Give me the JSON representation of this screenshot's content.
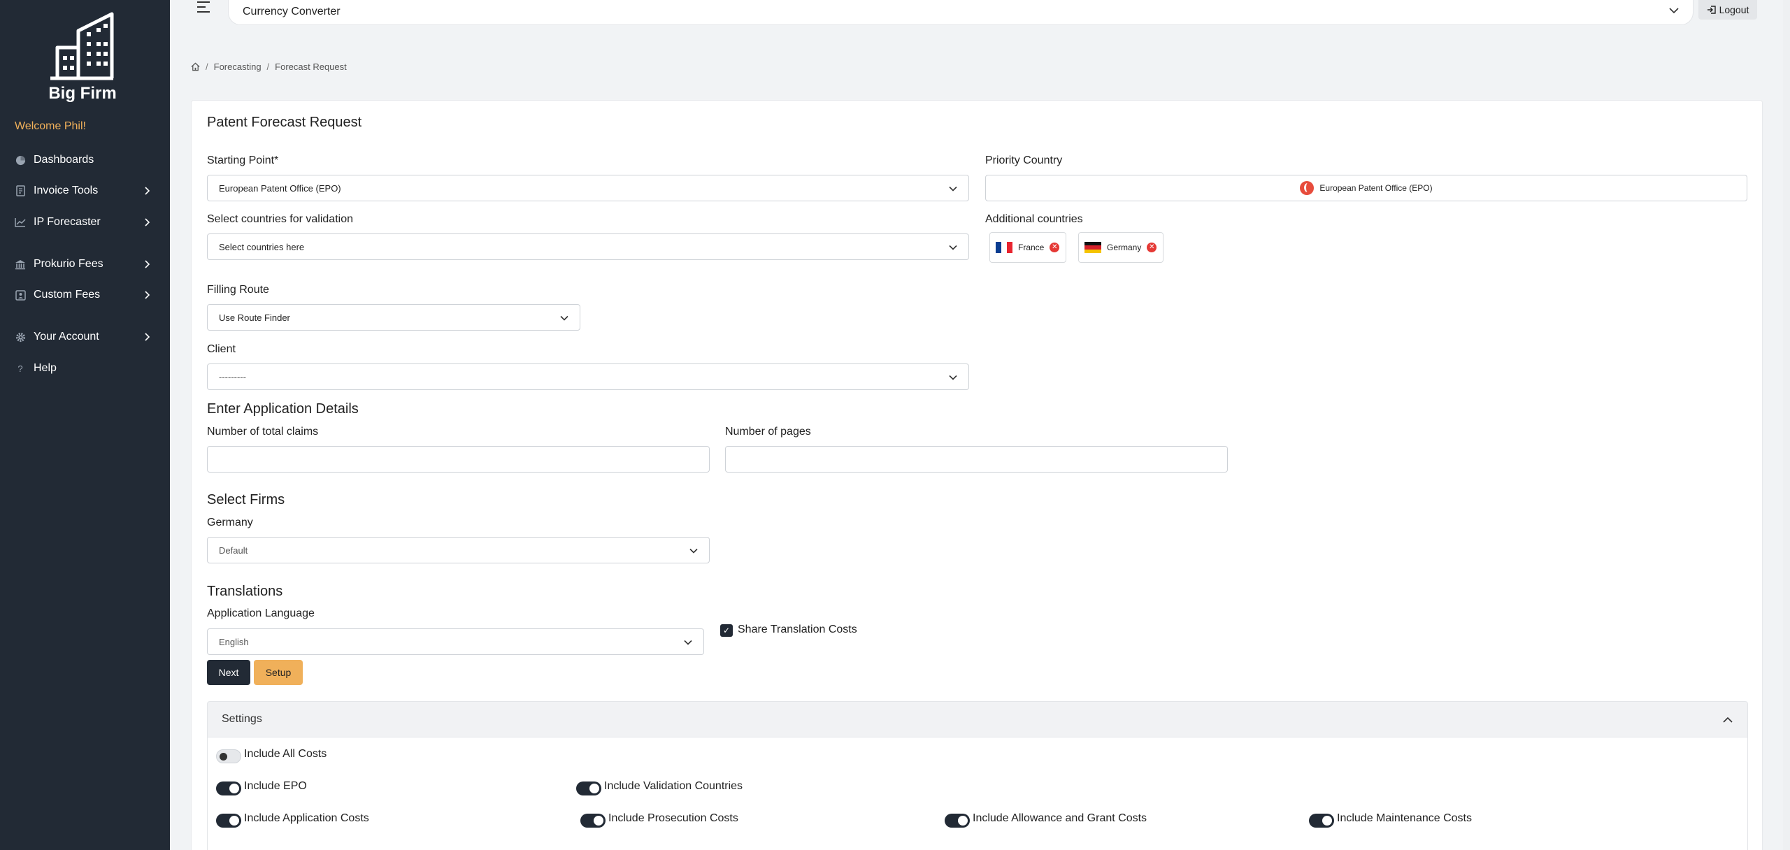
{
  "sidebar": {
    "brand": "Big Firm",
    "welcome": "Welcome Phil!",
    "items": [
      {
        "label": "Dashboards",
        "icon": "dashboard-icon"
      },
      {
        "label": "Invoice Tools",
        "icon": "invoice-icon"
      },
      {
        "label": "IP Forecaster",
        "icon": "chart-line-icon"
      },
      {
        "label": "Prokurio Fees",
        "icon": "bank-icon"
      },
      {
        "label": "Custom Fees",
        "icon": "user-card-icon"
      },
      {
        "label": "Your Account",
        "icon": "gear-icon"
      },
      {
        "label": "Help",
        "icon": "question-icon"
      }
    ]
  },
  "topbar": {
    "currency_label": "Currency Converter",
    "logout_label": "Logout"
  },
  "breadcrumb": {
    "items": [
      "Forecasting",
      "Forecast Request"
    ]
  },
  "form": {
    "title": "Patent Forecast Request",
    "starting_point_label": "Starting Point*",
    "starting_point_value": "European Patent Office (EPO)",
    "priority_country_label": "Priority Country",
    "priority_country_value": "European Patent Office (EPO)",
    "validation_label": "Select countries for validation",
    "validation_placeholder": "Select countries here",
    "additional_label": "Additional countries",
    "additional_countries": [
      "France",
      "Germany"
    ],
    "filing_route_label": "Filling Route",
    "filing_route_value": "Use Route Finder",
    "client_label": "Client",
    "client_value": "---------",
    "app_details_heading": "Enter Application Details",
    "claims_label": "Number of total claims",
    "pages_label": "Number of pages",
    "firms_heading": "Select Firms",
    "firm_country_label": "Germany",
    "firm_value": "Default",
    "translations_heading": "Translations",
    "app_language_label": "Application Language",
    "app_language_value": "English",
    "share_translation_label": "Share Translation Costs",
    "next_label": "Next",
    "setup_label": "Setup"
  },
  "settings": {
    "heading": "Settings",
    "include_all": "Include All Costs",
    "include_epo": "Include EPO",
    "include_validation": "Include Validation Countries",
    "include_application": "Include Application Costs",
    "include_prosecution": "Include Prosecution Costs",
    "include_allowance": "Include Allowance and Grant Costs",
    "include_maintenance": "Include Maintenance Costs"
  },
  "colors": {
    "sidebar_bg": "#222a35",
    "accent": "#f0b05a",
    "danger": "#e53935"
  }
}
